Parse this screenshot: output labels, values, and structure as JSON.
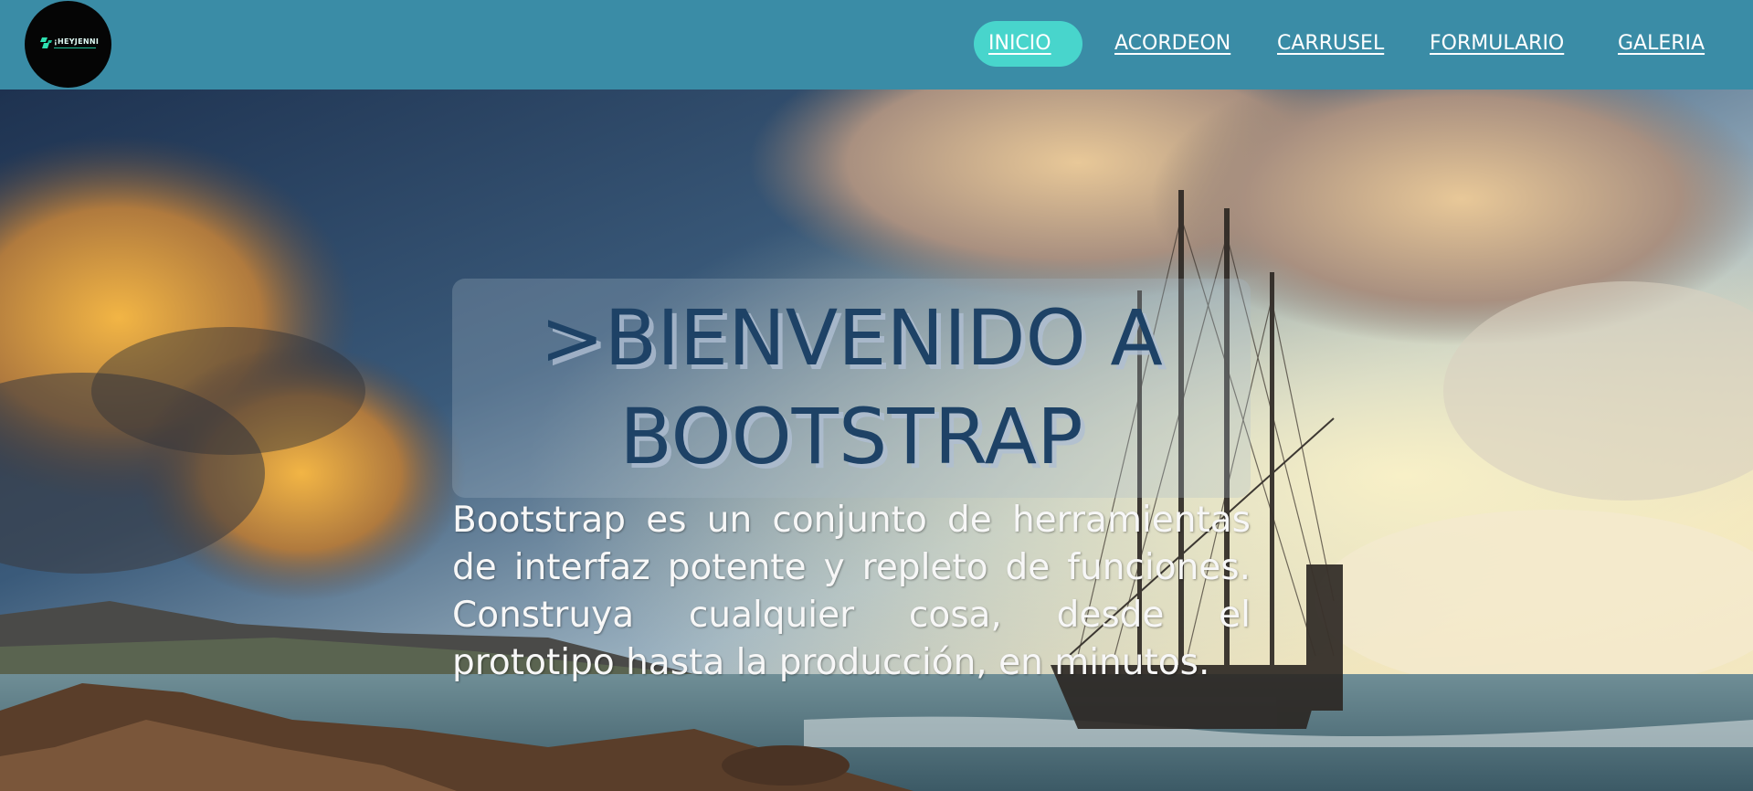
{
  "navbar": {
    "logo": {
      "text": "¡HEYJENNI",
      "icon": "logo-mark-icon"
    },
    "links": [
      {
        "label": "INICIO",
        "active": true
      },
      {
        "label": "ACORDEON",
        "active": false
      },
      {
        "label": "CARRUSEL",
        "active": false
      },
      {
        "label": "FORMULARIO",
        "active": false
      },
      {
        "label": "GALERIA",
        "active": false
      }
    ]
  },
  "hero": {
    "title": ">BIENVENIDO A BOOTSTRAP",
    "description": "Bootstrap es un conjunto de herramientas de interfaz potente y repleto de funciones. Construya cualquier cosa, desde el prototipo hasta la producción, en minutos."
  },
  "colors": {
    "navbar_bg": "#3a8ca6",
    "active_pill": "#48d5cc",
    "title_color": "#1e4266",
    "logo_bg": "#050505",
    "logo_accent": "#1fbf96"
  }
}
